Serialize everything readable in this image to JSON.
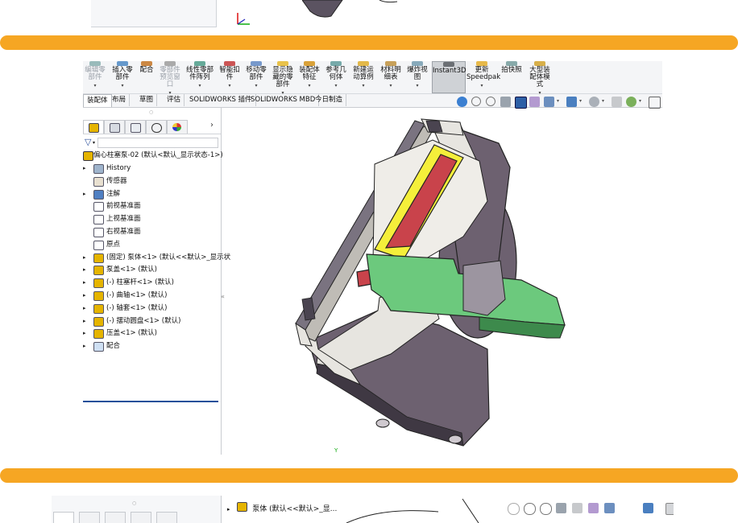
{
  "ribbon": {
    "buttons": [
      {
        "label": "编辑零\n部件",
        "dim": true
      },
      {
        "label": "插入零\n部件",
        "dim": false
      },
      {
        "label": "配合",
        "dim": false
      },
      {
        "label": "零部件\n预览窗\n口",
        "dim": true
      },
      {
        "label": "线性零部\n件阵列",
        "dim": false
      },
      {
        "label": "智能扣\n件",
        "dim": false
      },
      {
        "label": "移动零\n部件",
        "dim": false
      },
      {
        "label": "显示隐\n藏的零\n部件",
        "dim": false
      },
      {
        "label": "装配体\n特征",
        "dim": false
      },
      {
        "label": "参考几\n何体",
        "dim": false
      },
      {
        "label": "新建运\n动算例",
        "dim": false
      },
      {
        "label": "材料明\n细表",
        "dim": false
      },
      {
        "label": "爆炸视\n图",
        "dim": false
      },
      {
        "label": "Instant3D",
        "dim": false,
        "active": true
      },
      {
        "label": "更新\nSpeedpak",
        "dim": false
      },
      {
        "label": "拍快照",
        "dim": false
      },
      {
        "label": "大型装\n配体模\n式",
        "dim": false
      }
    ]
  },
  "tabs": [
    "装配体",
    "布局",
    "草图",
    "评估",
    "SOLIDWORKS 插件",
    "SOLIDWORKS MBD",
    "今日制造"
  ],
  "active_tab": "装配体",
  "tree": {
    "root": "偏心柱塞泵-02 (默认<默认_显示状态-1>)",
    "items": [
      {
        "label": "History",
        "icon": "history-folder-icon",
        "expand": true
      },
      {
        "label": "传感器",
        "icon": "sensor-icon",
        "expand": false
      },
      {
        "label": "注解",
        "icon": "annotation-icon",
        "expand": true
      },
      {
        "label": "前视基准面",
        "icon": "plane-icon",
        "expand": false
      },
      {
        "label": "上视基准面",
        "icon": "plane-icon",
        "expand": false
      },
      {
        "label": "右视基准面",
        "icon": "plane-icon",
        "expand": false
      },
      {
        "label": "原点",
        "icon": "origin-icon",
        "expand": false
      },
      {
        "label": "(固定) 泵体<1> (默认<<默认>_显示状",
        "icon": "part-icon",
        "expand": true
      },
      {
        "label": "泵盖<1> (默认)",
        "icon": "part-icon",
        "expand": true
      },
      {
        "label": "(-) 柱塞杆<1> (默认)",
        "icon": "part-icon",
        "expand": true
      },
      {
        "label": "(-) 曲轴<1> (默认)",
        "icon": "part-icon",
        "expand": true
      },
      {
        "label": "(-) 轴套<1> (默认)",
        "icon": "part-icon",
        "expand": true
      },
      {
        "label": "(-) 摆动圆盘<1> (默认)",
        "icon": "part-icon",
        "expand": true
      },
      {
        "label": "压盖<1> (默认)",
        "icon": "part-icon",
        "expand": true
      },
      {
        "label": "配合",
        "icon": "mates-icon",
        "expand": true
      }
    ]
  },
  "bottom": {
    "tree_label": "泵体 (默认<<默认>_显..."
  },
  "colors": {
    "divider_bar": "#f6a623",
    "section_yellow": "#f5ef3a",
    "section_red": "#c9434b",
    "section_green": "#6cc97d",
    "body_purple": "#6d6170",
    "body_light": "#e7e5e0"
  }
}
